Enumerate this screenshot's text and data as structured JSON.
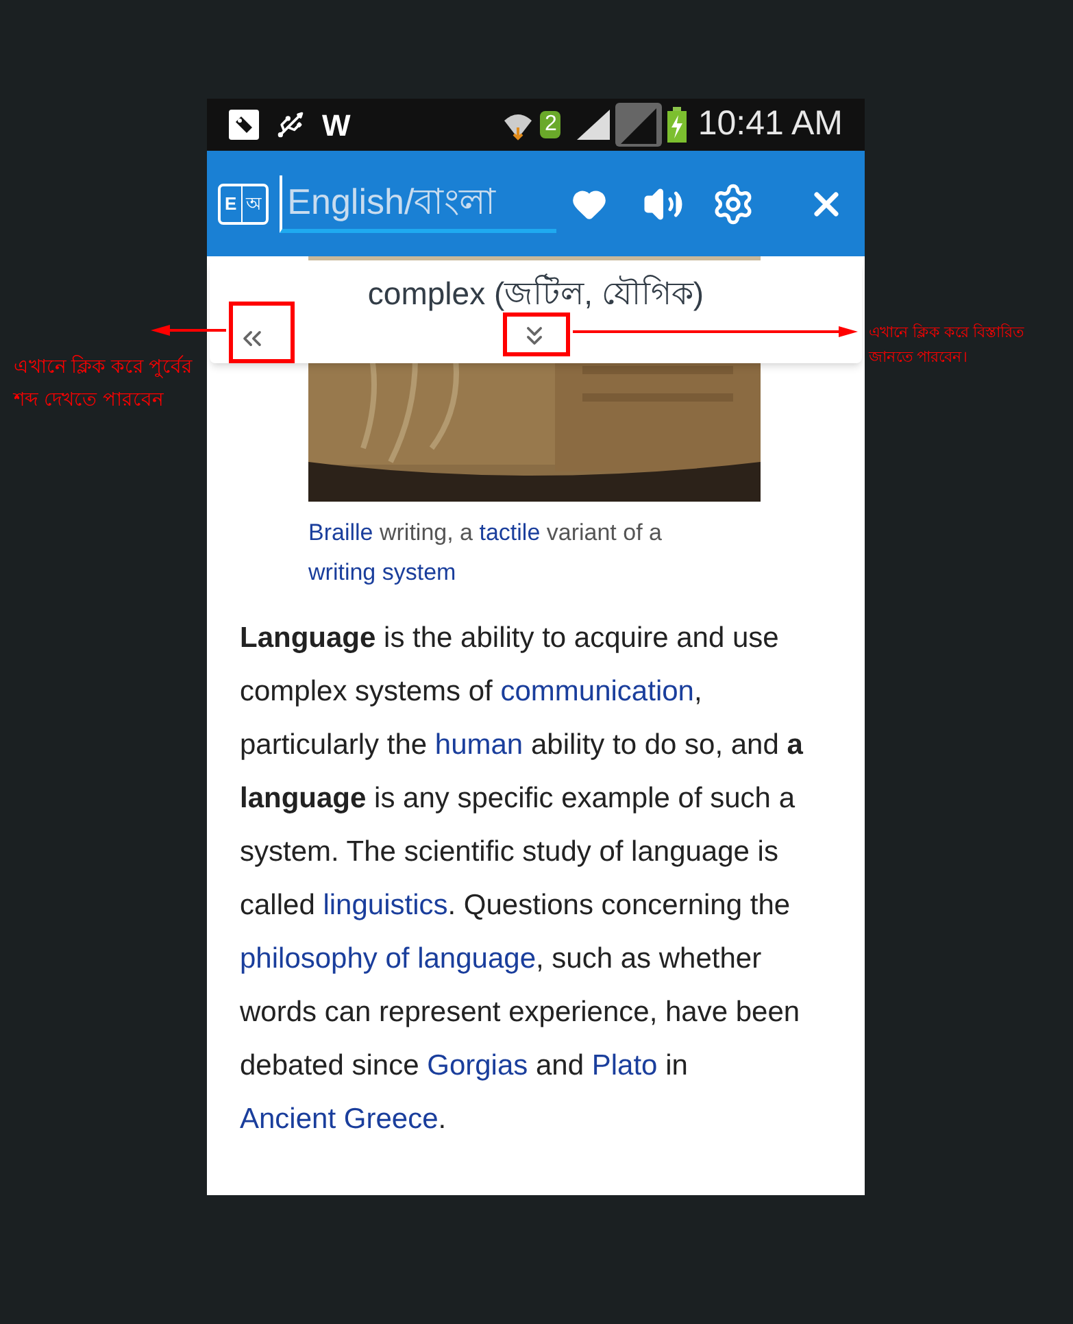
{
  "status_bar": {
    "notification_text": "W",
    "sim_badge": "2",
    "time": "10:41 AM"
  },
  "app_bar": {
    "logo_letters": [
      "E",
      "অ"
    ],
    "search": {
      "placeholder": "English/বাংলা"
    }
  },
  "word_popup": {
    "word": "complex (জটিল, যৌগিক)"
  },
  "caption": [
    {
      "kind": "link",
      "text": "Braille"
    },
    {
      "kind": "text",
      "text": " writing, a "
    },
    {
      "kind": "link",
      "text": "tactile"
    },
    {
      "kind": "text",
      "text": " variant of a "
    },
    {
      "kind": "link",
      "text": "writing system"
    }
  ],
  "article": [
    {
      "kind": "bold",
      "text": "Language"
    },
    {
      "kind": "text",
      "text": " is the ability to acquire and use complex systems of "
    },
    {
      "kind": "link",
      "text": "communication"
    },
    {
      "kind": "text",
      "text": ", particularly the "
    },
    {
      "kind": "link",
      "text": "human"
    },
    {
      "kind": "text",
      "text": " ability to do so, and "
    },
    {
      "kind": "bold",
      "text": "a language"
    },
    {
      "kind": "text",
      "text": " is any specific example of such a system. The scientific study of language is called "
    },
    {
      "kind": "link",
      "text": "linguistics"
    },
    {
      "kind": "text",
      "text": ". Questions concerning the "
    },
    {
      "kind": "link",
      "text": "philosophy of language"
    },
    {
      "kind": "text",
      "text": ", such as whether words can represent experience, have been debated since "
    },
    {
      "kind": "link",
      "text": "Gorgias"
    },
    {
      "kind": "text",
      "text": " and "
    },
    {
      "kind": "link",
      "text": "Plato"
    },
    {
      "kind": "text",
      "text": " in "
    },
    {
      "kind": "link",
      "text": "Ancient Greece"
    },
    {
      "kind": "text",
      "text": "."
    }
  ],
  "annotations": [
    {
      "text": "এখানে ক্লিক করে পুর্বের শব্দ দেখতে পারবেন"
    },
    {
      "text": "এখানে ক্লিক করে বিস্তারিত জানতে পারবেন।"
    }
  ]
}
